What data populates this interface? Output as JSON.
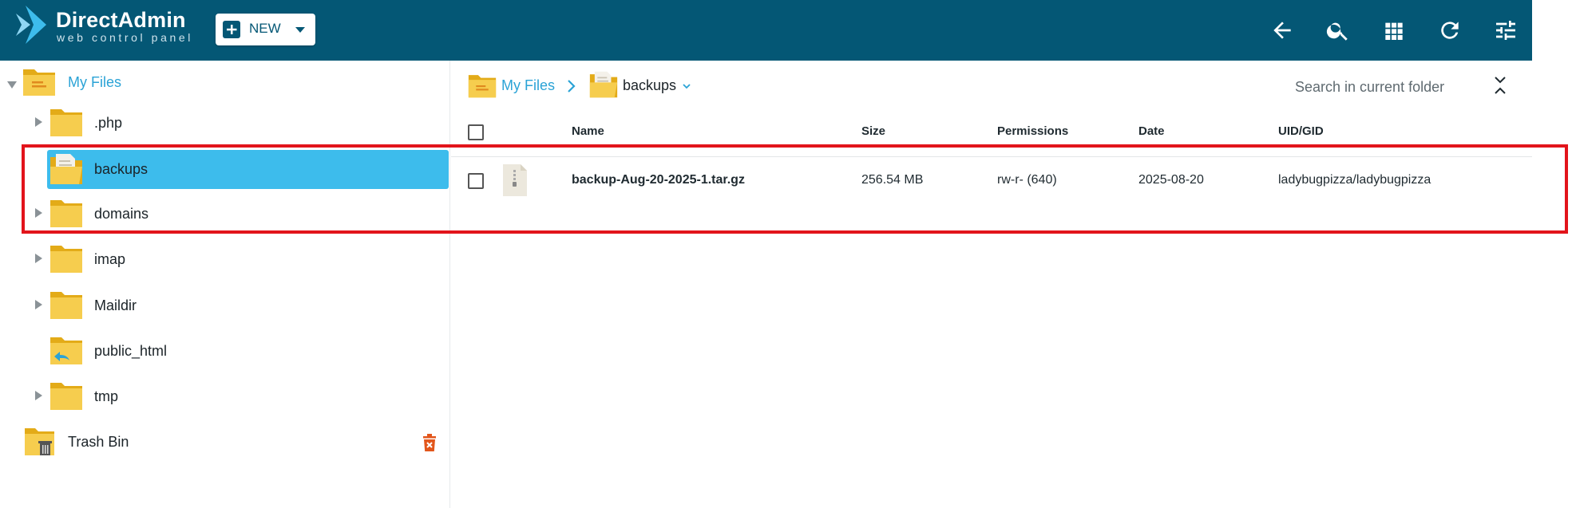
{
  "app": {
    "brand": "DirectAdmin",
    "tagline": "web control panel",
    "brand_color": "#045775",
    "accent_color": "#3dbcec"
  },
  "toolbar": {
    "new_label": "NEW",
    "icons": [
      "back-arrow-icon",
      "search-icon",
      "grid-view-icon",
      "refresh-icon",
      "settings-sliders-icon"
    ]
  },
  "tree": {
    "root": {
      "label": "My Files"
    },
    "items": [
      {
        "label": ".php",
        "expandable": true,
        "selected": false
      },
      {
        "label": "backups",
        "expandable": false,
        "selected": true
      },
      {
        "label": "domains",
        "expandable": true,
        "selected": false
      },
      {
        "label": "imap",
        "expandable": true,
        "selected": false
      },
      {
        "label": "Maildir",
        "expandable": true,
        "selected": false
      },
      {
        "label": "public_html",
        "expandable": false,
        "selected": false
      },
      {
        "label": "tmp",
        "expandable": true,
        "selected": false
      }
    ],
    "trash": {
      "label": "Trash Bin"
    }
  },
  "breadcrumb": {
    "root": "My Files",
    "current": "backups"
  },
  "search": {
    "placeholder": "Search in current folder"
  },
  "table": {
    "columns": [
      "Name",
      "Size",
      "Permissions",
      "Date",
      "UID/GID"
    ],
    "rows": [
      {
        "name": "backup-Aug-20-2025-1.tar.gz",
        "size": "256.54 MB",
        "permissions": "rw-r- (640)",
        "date": "2025-08-20",
        "uid_gid": "ladybugpizza/ladybugpizza"
      }
    ]
  }
}
